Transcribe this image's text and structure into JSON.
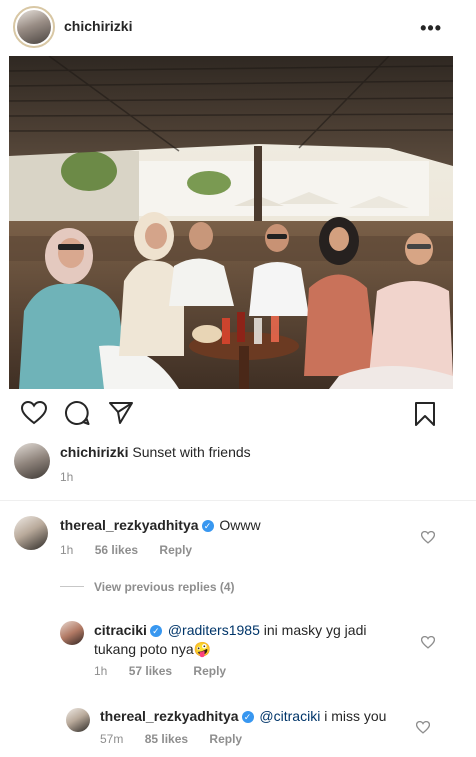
{
  "post": {
    "username": "chichirizki",
    "caption_username": "chichirizki",
    "caption_text": "Sunset with friends",
    "caption_time": "1h"
  },
  "comments": [
    {
      "username": "thereal_rezkyadhitya",
      "text": "Owww",
      "time": "1h",
      "likes": "56 likes",
      "reply": "Reply"
    }
  ],
  "view_previous": "View previous replies (4)",
  "replies": [
    {
      "username": "citraciki",
      "mention": "@raditers1985",
      "text_line1": "ini masky yg jadi",
      "text_line2": "tukang poto nya",
      "emoji": "🤪",
      "time": "1h",
      "likes": "57 likes",
      "reply": "Reply"
    },
    {
      "username": "thereal_rezkyadhitya",
      "mention": "@citraciki",
      "text": "i miss you",
      "time": "57m",
      "likes": "85 likes",
      "reply": "Reply"
    }
  ],
  "icons": {
    "more": "ellipsis-icon",
    "like": "heart-icon",
    "comment": "comment-icon",
    "share": "send-icon",
    "save": "bookmark-icon",
    "verified": "verified-badge-icon"
  },
  "colors": {
    "text": "#262626",
    "secondary": "#8e8e8e",
    "verified": "#3897f0",
    "mention": "#003569"
  }
}
